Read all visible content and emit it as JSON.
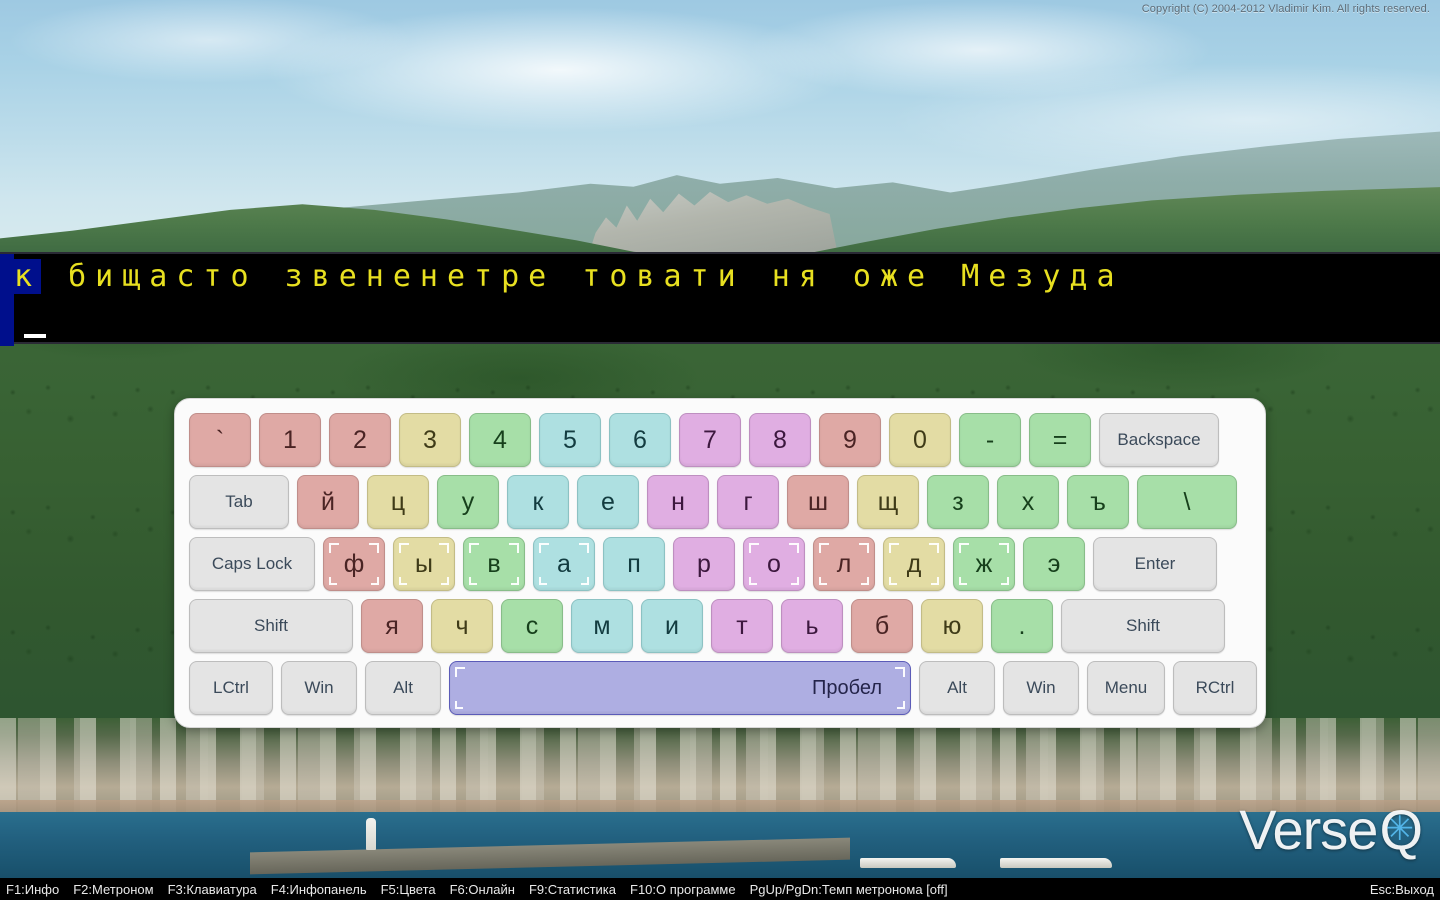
{
  "app": {
    "title": "VerseQ",
    "copyright": "Copyright (C) 2004-2012 Vladimir Kim. All rights reserved.",
    "logo_main": "Verse",
    "logo_q": "Q",
    "logo_star": "✳"
  },
  "practice": {
    "line1_prefix": "к",
    "line1_rest": " бищасто звененетре товати ня оже Мезуда",
    "line2": "",
    "caret": "_",
    "highlight_color": "#000f8c",
    "text_color": "#e8e020",
    "background_color": "#000000"
  },
  "keyboard": {
    "rows": [
      [
        {
          "label": "`",
          "color": "red",
          "w": "w1",
          "home": false
        },
        {
          "label": "1",
          "color": "red",
          "w": "w1",
          "home": false
        },
        {
          "label": "2",
          "color": "red",
          "w": "w1",
          "home": false
        },
        {
          "label": "3",
          "color": "khaki",
          "w": "w1",
          "home": false
        },
        {
          "label": "4",
          "color": "green",
          "w": "w1",
          "home": false
        },
        {
          "label": "5",
          "color": "cyan",
          "w": "w1",
          "home": false
        },
        {
          "label": "6",
          "color": "cyan",
          "w": "w1",
          "home": false
        },
        {
          "label": "7",
          "color": "pink",
          "w": "w1",
          "home": false
        },
        {
          "label": "8",
          "color": "pink",
          "w": "w1",
          "home": false
        },
        {
          "label": "9",
          "color": "red",
          "w": "w1",
          "home": false
        },
        {
          "label": "0",
          "color": "khaki",
          "w": "w1",
          "home": false
        },
        {
          "label": "-",
          "color": "green",
          "w": "w1",
          "home": false
        },
        {
          "label": "=",
          "color": "green",
          "w": "w1",
          "home": false
        },
        {
          "label": "Backspace",
          "color": "mod",
          "w": "wbsp",
          "home": false
        }
      ],
      [
        {
          "label": "Tab",
          "color": "mod",
          "w": "wtab",
          "home": false
        },
        {
          "label": "й",
          "color": "red",
          "w": "w1",
          "home": false
        },
        {
          "label": "ц",
          "color": "khaki",
          "w": "w1",
          "home": false
        },
        {
          "label": "у",
          "color": "green",
          "w": "w1",
          "home": false
        },
        {
          "label": "к",
          "color": "cyan",
          "w": "w1",
          "home": false
        },
        {
          "label": "е",
          "color": "cyan",
          "w": "w1",
          "home": false
        },
        {
          "label": "н",
          "color": "pink",
          "w": "w1",
          "home": false
        },
        {
          "label": "г",
          "color": "pink",
          "w": "w1",
          "home": false
        },
        {
          "label": "ш",
          "color": "red",
          "w": "w1",
          "home": false
        },
        {
          "label": "щ",
          "color": "khaki",
          "w": "w1",
          "home": false
        },
        {
          "label": "з",
          "color": "green",
          "w": "w1",
          "home": false
        },
        {
          "label": "х",
          "color": "green",
          "w": "w1",
          "home": false
        },
        {
          "label": "ъ",
          "color": "green",
          "w": "w1",
          "home": false
        },
        {
          "label": "\\",
          "color": "green",
          "w": "wbsl",
          "home": false
        }
      ],
      [
        {
          "label": "Caps Lock",
          "color": "mod",
          "w": "wcap",
          "home": false
        },
        {
          "label": "ф",
          "color": "red",
          "w": "w1",
          "home": true
        },
        {
          "label": "ы",
          "color": "khaki",
          "w": "w1",
          "home": true
        },
        {
          "label": "в",
          "color": "green",
          "w": "w1",
          "home": true
        },
        {
          "label": "а",
          "color": "cyan",
          "w": "w1",
          "home": true
        },
        {
          "label": "п",
          "color": "cyan",
          "w": "w1",
          "home": false
        },
        {
          "label": "р",
          "color": "pink",
          "w": "w1",
          "home": false
        },
        {
          "label": "о",
          "color": "pink",
          "w": "w1",
          "home": true
        },
        {
          "label": "л",
          "color": "red",
          "w": "w1",
          "home": true
        },
        {
          "label": "д",
          "color": "khaki",
          "w": "w1",
          "home": true
        },
        {
          "label": "ж",
          "color": "green",
          "w": "w1",
          "home": true
        },
        {
          "label": "э",
          "color": "green",
          "w": "w1",
          "home": false
        },
        {
          "label": "Enter",
          "color": "mod",
          "w": "went",
          "home": false
        }
      ],
      [
        {
          "label": "Shift",
          "color": "mod",
          "w": "wsh",
          "home": false
        },
        {
          "label": "я",
          "color": "red",
          "w": "w1",
          "home": false
        },
        {
          "label": "ч",
          "color": "khaki",
          "w": "w1",
          "home": false
        },
        {
          "label": "с",
          "color": "green",
          "w": "w1",
          "home": false
        },
        {
          "label": "м",
          "color": "cyan",
          "w": "w1",
          "home": false
        },
        {
          "label": "и",
          "color": "cyan",
          "w": "w1",
          "home": false
        },
        {
          "label": "т",
          "color": "pink",
          "w": "w1",
          "home": false
        },
        {
          "label": "ь",
          "color": "pink",
          "w": "w1",
          "home": false
        },
        {
          "label": "б",
          "color": "red",
          "w": "w1",
          "home": false
        },
        {
          "label": "ю",
          "color": "khaki",
          "w": "w1",
          "home": false
        },
        {
          "label": ".",
          "color": "green",
          "w": "w1",
          "home": false
        },
        {
          "label": "Shift",
          "color": "mod",
          "w": "wsh2",
          "home": false
        }
      ],
      [
        {
          "label": "LCtrl",
          "color": "mod",
          "w": "wctl",
          "home": false
        },
        {
          "label": "Win",
          "color": "mod",
          "w": "wwin",
          "home": false
        },
        {
          "label": "Alt",
          "color": "mod",
          "w": "walt",
          "home": false
        },
        {
          "label": "Пробел",
          "color": "space",
          "w": "wspc",
          "home": true
        },
        {
          "label": "Alt",
          "color": "mod",
          "w": "walt",
          "home": false
        },
        {
          "label": "Win",
          "color": "mod",
          "w": "wwin",
          "home": false
        },
        {
          "label": "Menu",
          "color": "mod",
          "w": "wmen",
          "home": false
        },
        {
          "label": "RCtrl",
          "color": "mod",
          "w": "wctl",
          "home": false
        }
      ]
    ],
    "colors": {
      "red": "#dfa9a5",
      "khaki": "#e3dca4",
      "green": "#a7dfa8",
      "cyan": "#aee0e1",
      "pink": "#e0aee2",
      "space": "#aeaee2",
      "modifier": "#e4e4e4"
    }
  },
  "statusbar": {
    "items": [
      "F1:Инфо",
      "F2:Метроном",
      "F3:Клавиатура",
      "F4:Инфопанель",
      "F5:Цвета",
      "F6:Онлайн",
      "F9:Статистика",
      "F10:О программе",
      "PgUp/PgDn:Темп метронома [off]"
    ],
    "exit": "Esc:Выход"
  }
}
